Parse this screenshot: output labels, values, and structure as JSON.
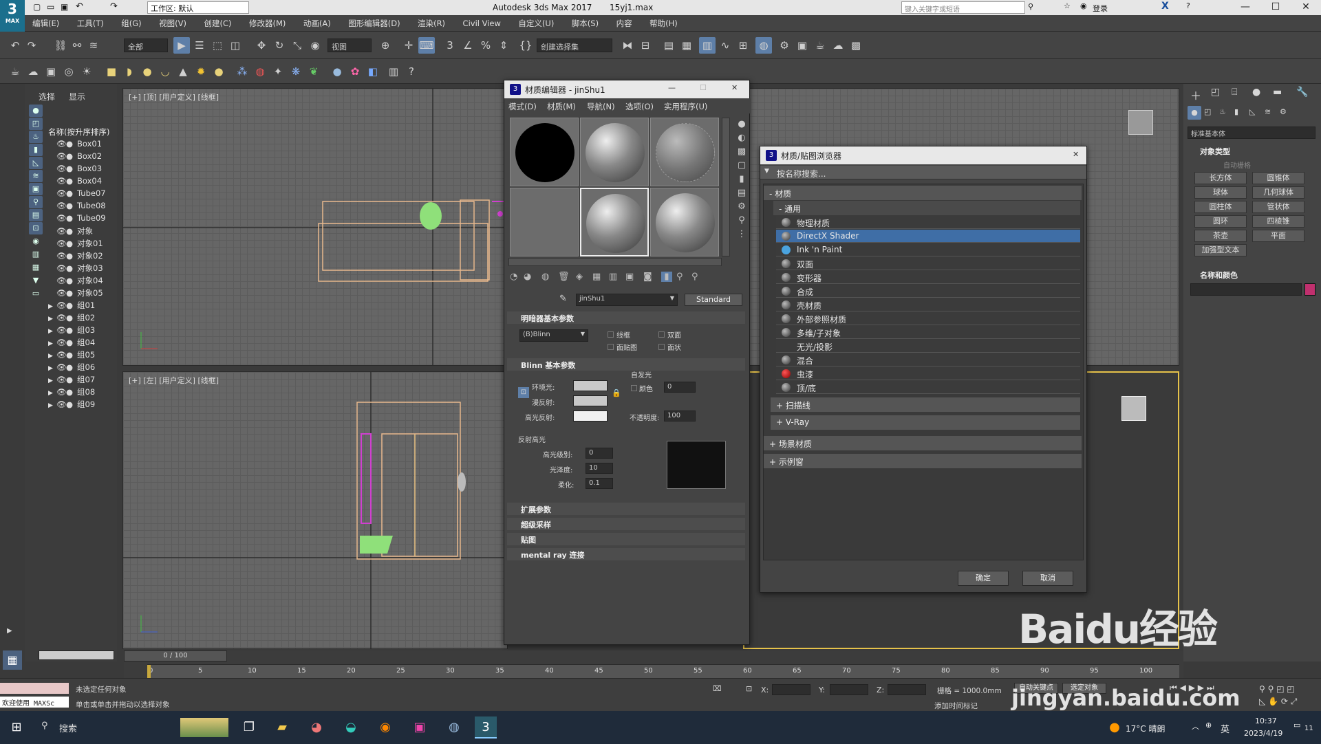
{
  "app": {
    "logo_text": "MAX",
    "workspace_label": "工作区: 默认",
    "title": "Autodesk 3ds Max 2017",
    "filename": "15yj1.max",
    "search_placeholder": "键入关键字或短语",
    "login_label": "登录"
  },
  "menu": [
    "编辑(E)",
    "工具(T)",
    "组(G)",
    "视图(V)",
    "创建(C)",
    "修改器(M)",
    "动画(A)",
    "图形编辑器(D)",
    "渲染(R)",
    "Civil View",
    "自定义(U)",
    "脚本(S)",
    "内容",
    "帮助(H)"
  ],
  "toolbar": {
    "filter_label": "全部",
    "view_label": "视图",
    "selection_set_label": "创建选择集"
  },
  "scene_explorer": {
    "tabs": [
      "选择",
      "显示"
    ],
    "column_header": "名称(按升序排序)",
    "objects": [
      "Box01",
      "Box02",
      "Box03",
      "Box04",
      "Tube07",
      "Tube08",
      "Tube09",
      "对象",
      "对象01",
      "对象02",
      "对象03",
      "对象04",
      "对象05"
    ],
    "groups": [
      "组01",
      "组02",
      "组03",
      "组04",
      "组05",
      "组06",
      "组07",
      "组08",
      "组09"
    ]
  },
  "viewports": {
    "top_label": "[+] [顶] [用户定义] [线框]",
    "left_label": "[+] [左] [用户定义] [线框]"
  },
  "material_editor": {
    "title": "材质编辑器 - jinShu1",
    "menu": [
      "模式(D)",
      "材质(M)",
      "导航(N)",
      "选项(O)",
      "实用程序(U)"
    ],
    "material_name": "jinShu1",
    "material_type": "Standard",
    "rollout_shader": "明暗器基本参数",
    "shader_value": "(B)Blinn",
    "checkbox_labels": [
      "线框",
      "双面",
      "面贴图",
      "面状"
    ],
    "rollout_blinn": "Blinn 基本参数",
    "self_illum_label": "自发光",
    "color_label": "颜色",
    "self_illum_value": "0",
    "ambient_label": "环境光:",
    "diffuse_label": "漫反射:",
    "specular_label": "高光反射:",
    "opacity_label": "不透明度:",
    "opacity_value": "100",
    "highlight_group": "反射高光",
    "spec_level_label": "高光级别:",
    "spec_level_value": "0",
    "gloss_label": "光泽度:",
    "gloss_value": "10",
    "soften_label": "柔化:",
    "soften_value": "0.1",
    "rollouts": [
      "扩展参数",
      "超级采样",
      "贴图",
      "mental ray 连接"
    ]
  },
  "browser": {
    "title": "材质/贴图浏览器",
    "search_label": "按名称搜索...",
    "cat_material": "- 材质",
    "cat_general": "- 通用",
    "items": [
      "物理材质",
      "DirectX Shader",
      "Ink 'n Paint",
      "双面",
      "变形器",
      "合成",
      "壳材质",
      "外部参照材质",
      "多维/子对象",
      "无光/投影",
      "混合",
      "虫漆",
      "顶/底"
    ],
    "sections": [
      "+ 扫描线",
      "+ V-Ray"
    ],
    "root_sections": [
      "+ 场景材质",
      "+ 示例窗"
    ],
    "ok_label": "确定",
    "cancel_label": "取消",
    "selected_index": 1
  },
  "command_panel": {
    "dropdown": "标准基本体",
    "object_type_header": "对象类型",
    "autogrid_label": "自动栅格",
    "buttons": [
      "长方体",
      "圆锥体",
      "球体",
      "几何球体",
      "圆柱体",
      "管状体",
      "圆环",
      "四棱锥",
      "茶壶",
      "平面",
      "加强型文本"
    ],
    "name_color_header": "名称和颜色",
    "accent_color": "#c0306e"
  },
  "timeline": {
    "frame_label": "0 / 100",
    "ticks": [
      "0",
      "5",
      "10",
      "15",
      "20",
      "25",
      "30",
      "35",
      "40",
      "45",
      "50",
      "55",
      "60",
      "65",
      "70",
      "75",
      "80",
      "85",
      "90",
      "95",
      "100"
    ]
  },
  "status": {
    "maxscript_label": "欢迎使用 MAXSc",
    "line1": "未选定任何对象",
    "line2": "单击或单击并拖动以选择对象",
    "x_label": "X:",
    "y_label": "Y:",
    "z_label": "Z:",
    "grid_label": "栅格 = 1000.0mm",
    "add_time_tag": "添加时间标记",
    "auto_key": "自动关键点",
    "selected_object": "选定对象"
  },
  "taskbar": {
    "search_label": "搜索",
    "weather": "17°C 晴朗",
    "ime": "英",
    "time": "10:37",
    "date": "2023/4/19",
    "notification_count": "11"
  },
  "watermark": {
    "text": "Baidu经验",
    "url": "jingyan.baidu.com"
  }
}
